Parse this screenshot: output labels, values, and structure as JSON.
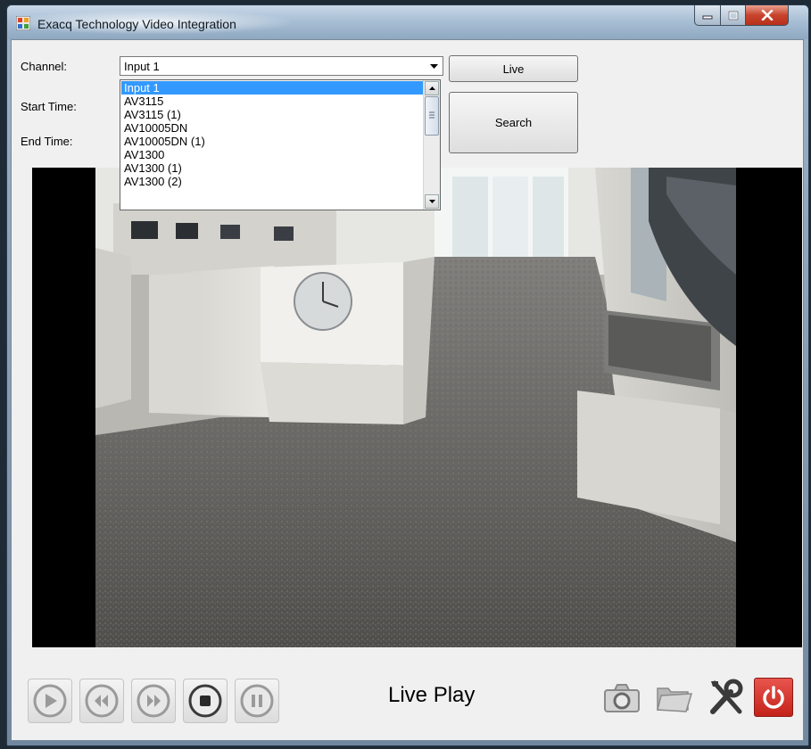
{
  "window": {
    "title": "Exacq Technology Video Integration",
    "controls": [
      "minimize",
      "maximize",
      "close"
    ]
  },
  "form": {
    "channel_label": "Channel:",
    "start_time_label": "Start Time:",
    "end_time_label": "End Time:",
    "channel_value": "Input 1",
    "live_button": "Live",
    "search_button": "Search"
  },
  "dropdown": {
    "selected_index": 0,
    "items": [
      "Input 1",
      "AV3115",
      "AV3115 (1)",
      "AV10005DN",
      "AV10005DN (1)",
      "AV1300",
      "AV1300 (1)",
      "AV1300 (2)"
    ]
  },
  "playback": {
    "status": "Live Play",
    "buttons": [
      "play",
      "rewind",
      "fast-forward",
      "stop",
      "pause"
    ]
  },
  "toolbar": {
    "icons": [
      "camera-icon",
      "folder-icon",
      "tools-icon",
      "power-icon"
    ]
  },
  "colors": {
    "selection": "#3399ff",
    "power_button": "#d9312a",
    "video_background": "#000000"
  }
}
